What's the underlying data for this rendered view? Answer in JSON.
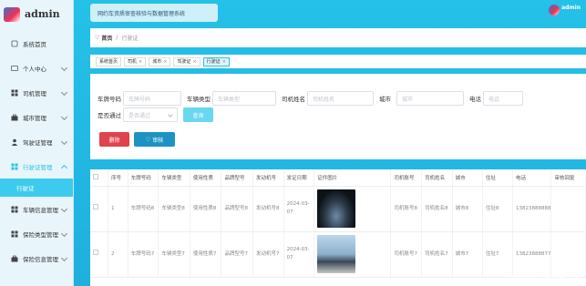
{
  "brand": {
    "name": "admin"
  },
  "sidebar": {
    "items": [
      {
        "label": "系统首页",
        "icon": "home-icon"
      },
      {
        "label": "个人中心",
        "icon": "id-card-icon"
      },
      {
        "label": "司机管理",
        "icon": "grid-icon"
      },
      {
        "label": "城市管理",
        "icon": "briefcase-icon"
      },
      {
        "label": "驾驶证管理",
        "icon": "user-icon"
      },
      {
        "label": "行驶证管理",
        "icon": "grid-icon"
      },
      {
        "label": "车辆信息管理",
        "icon": "grid-icon"
      },
      {
        "label": "保险类型管理",
        "icon": "grid-icon"
      },
      {
        "label": "保险信息管理",
        "icon": "briefcase-icon"
      }
    ],
    "sub_item": "行驶证"
  },
  "header": {
    "system_title": "网约车资质审查核验与数据管理系统",
    "user": "admin"
  },
  "breadcrumb": {
    "home": "首页",
    "current": "行驶证"
  },
  "tabs": [
    "系统首页",
    "司机",
    "城市",
    "驾驶证",
    "行驶证"
  ],
  "filters": {
    "plate_label": "车牌号码",
    "plate_placeholder": "车牌号码",
    "type_label": "车辆类型",
    "type_placeholder": "车辆类型",
    "driver_label": "司机姓名",
    "driver_placeholder": "司机姓名",
    "city_label": "城市",
    "city_placeholder": "城市",
    "phone_label": "电话",
    "phone_placeholder": "电话",
    "audit_label": "是否通过",
    "audit_placeholder": "是否通过",
    "search": "查询"
  },
  "actions": {
    "delete": "删除",
    "audit": "审核"
  },
  "table": {
    "columns": [
      "序号",
      "车牌号码",
      "车辆类型",
      "使用性质",
      "品牌型号",
      "发动机号",
      "发证日期",
      "证件图片",
      "司机账号",
      "司机姓名",
      "城市",
      "住址",
      "电话",
      "审核回复"
    ],
    "rows": [
      {
        "no": "1",
        "plate": "车牌号码8",
        "type": "车辆类型8",
        "nature": "使用性质8",
        "brand": "品牌型号8",
        "engine": "发动机号8",
        "date": "2024-03-07",
        "image": "car-image-1",
        "account": "司机账号8",
        "driver": "司机姓名8",
        "city": "城市8",
        "addr": "住址8",
        "phone": "13823888888",
        "reply": ""
      },
      {
        "no": "2",
        "plate": "车牌号码7",
        "type": "车辆类型7",
        "nature": "使用性质7",
        "brand": "品牌型号7",
        "engine": "发动机号7",
        "date": "2024-03-07",
        "image": "car-image-2",
        "account": "司机账号7",
        "driver": "司机姓名7",
        "city": "城市7",
        "addr": "住址7",
        "phone": "13823888877",
        "reply": ""
      }
    ]
  },
  "watermark": "CSDN @全侍程序毕设"
}
